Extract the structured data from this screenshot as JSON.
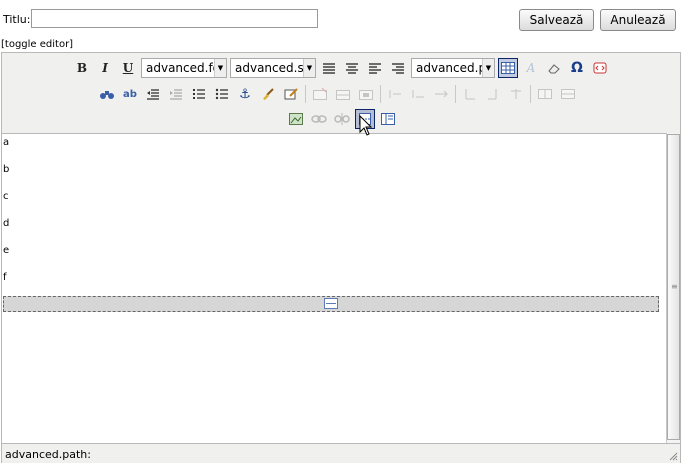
{
  "form": {
    "title_label": "Titlu:",
    "title_value": "",
    "save_label": "Salvează",
    "cancel_label": "Anulează",
    "toggle_label": "[toggle editor]"
  },
  "toolbar": {
    "font_select": "advanced.fo",
    "style_select": "advanced.st",
    "format_select": "advanced.pa",
    "bold": "B",
    "italic": "I",
    "underline": "U",
    "special_char": "Ω"
  },
  "content": {
    "lines": [
      "a",
      "b",
      "c",
      "d",
      "e",
      "f"
    ]
  },
  "status": {
    "path_label": "advanced.path:"
  }
}
